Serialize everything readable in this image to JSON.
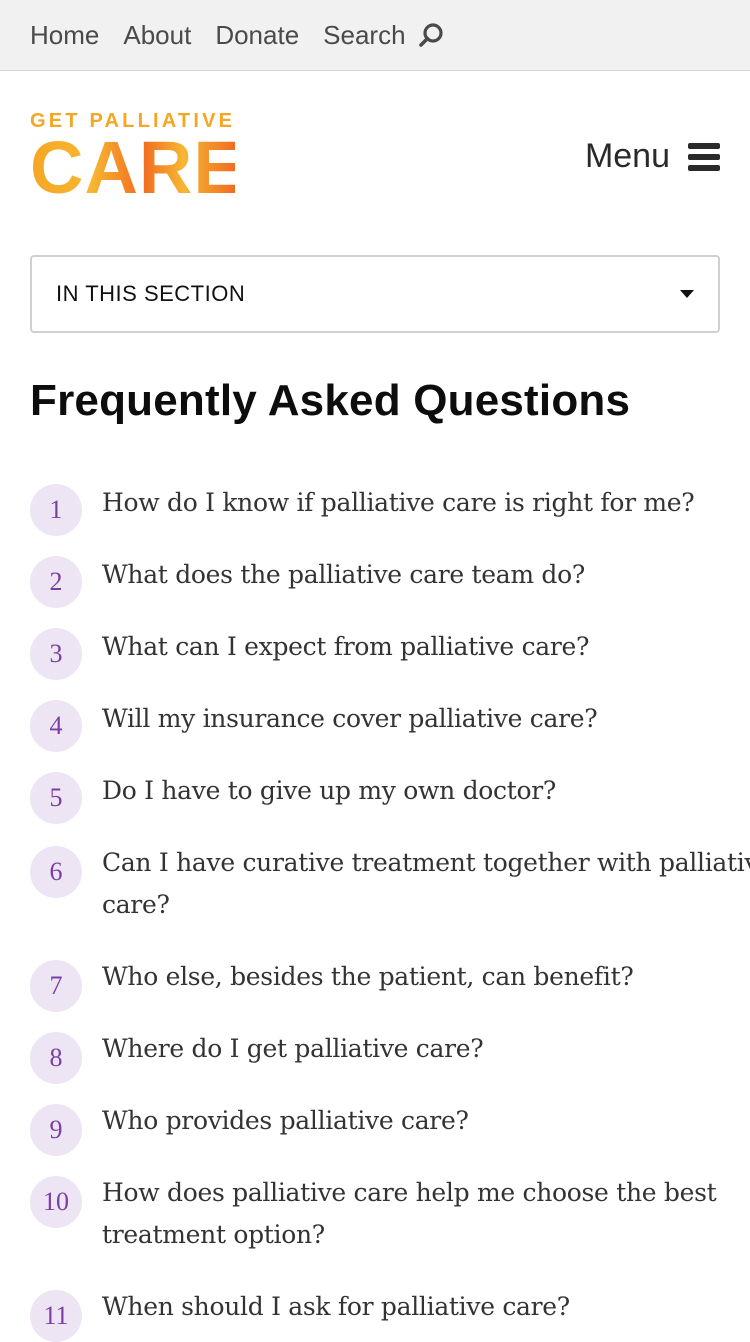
{
  "topnav": {
    "home": "Home",
    "about": "About",
    "donate": "Donate",
    "search": "Search"
  },
  "logo": {
    "small": "GET PALLIATIVE",
    "big": "CARE"
  },
  "menu": {
    "label": "Menu"
  },
  "section": {
    "label": "IN THIS SECTION"
  },
  "page": {
    "title": "Frequently Asked Questions"
  },
  "colors": {
    "accent_purple": "#7b3fa4",
    "badge_bg": "#ede4f4",
    "logo_orange": "#f5a623"
  },
  "faq": [
    {
      "num": "1",
      "q": "How do I know if palliative care is right for me?"
    },
    {
      "num": "2",
      "q": "What does the palliative care team do?"
    },
    {
      "num": "3",
      "q": "What can I expect from palliative care?"
    },
    {
      "num": "4",
      "q": "Will my insurance cover palliative care?"
    },
    {
      "num": "5",
      "q": "Do I have to give up my own doctor?"
    },
    {
      "num": "6",
      "q": "Can I have curative treatment together with palliative care?"
    },
    {
      "num": "7",
      "q": "Who else, besides the patient, can benefit?"
    },
    {
      "num": "8",
      "q": "Where do I get palliative care?"
    },
    {
      "num": "9",
      "q": "Who provides palliative care?"
    },
    {
      "num": "10",
      "q": "How does palliative care help me choose the best treatment option?"
    },
    {
      "num": "11",
      "q": "When should I ask for palliative care?"
    }
  ]
}
